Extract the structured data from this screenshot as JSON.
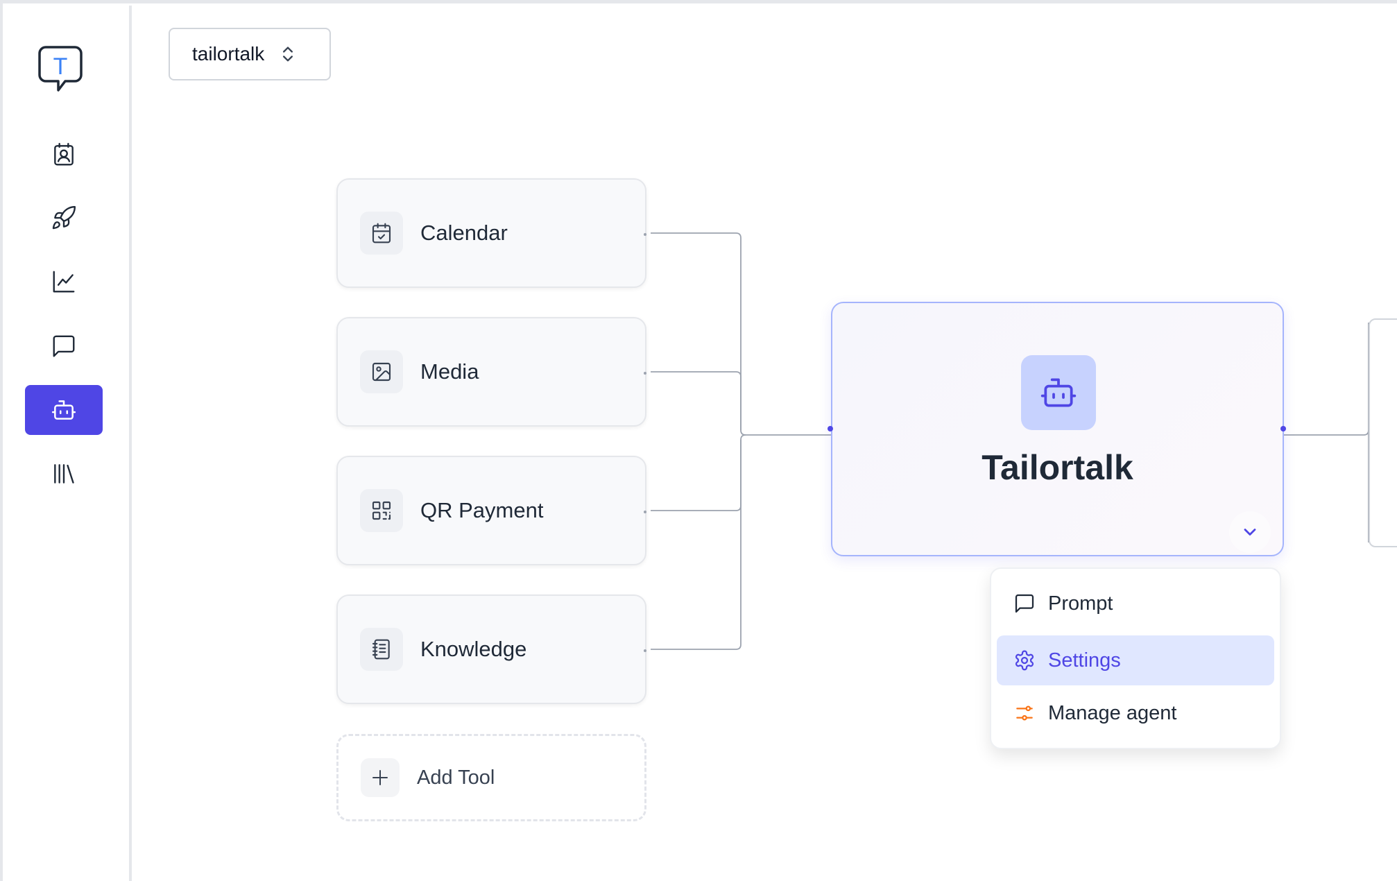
{
  "workspace": {
    "name": "tailortalk"
  },
  "sidebar": {
    "logo_letter": "T",
    "items": [
      {
        "name": "contacts",
        "icon": "contact-book-icon",
        "active": false
      },
      {
        "name": "campaigns",
        "icon": "rocket-icon",
        "active": false
      },
      {
        "name": "analytics",
        "icon": "chart-line-icon",
        "active": false
      },
      {
        "name": "conversations",
        "icon": "chat-bubble-icon",
        "active": false
      },
      {
        "name": "agents",
        "icon": "bot-icon",
        "active": true
      },
      {
        "name": "library",
        "icon": "library-icon",
        "active": false
      }
    ]
  },
  "tools": [
    {
      "label": "Calendar",
      "icon": "calendar-check-icon"
    },
    {
      "label": "Media",
      "icon": "image-icon"
    },
    {
      "label": "QR Payment",
      "icon": "qr-code-icon"
    },
    {
      "label": "Knowledge",
      "icon": "notebook-icon"
    }
  ],
  "add_tool": {
    "label": "Add Tool",
    "icon": "plus-icon"
  },
  "agent": {
    "name": "Tailortalk",
    "icon": "bot-icon",
    "toggle_icon": "chevron-down-icon"
  },
  "menu": {
    "items": [
      {
        "label": "Prompt",
        "icon": "message-square-icon",
        "active": false
      },
      {
        "label": "Settings",
        "icon": "settings-gear-icon",
        "active": true
      },
      {
        "label": "Manage agent",
        "icon": "sliders-toggle-icon",
        "active": false
      }
    ]
  },
  "colors": {
    "accent": "#4f46e5",
    "accent_light": "#e0e7ff",
    "agent_icon_bg": "#c7d2fe",
    "manage_icon": "#f97316",
    "logo_letter": "#3b82f6"
  }
}
